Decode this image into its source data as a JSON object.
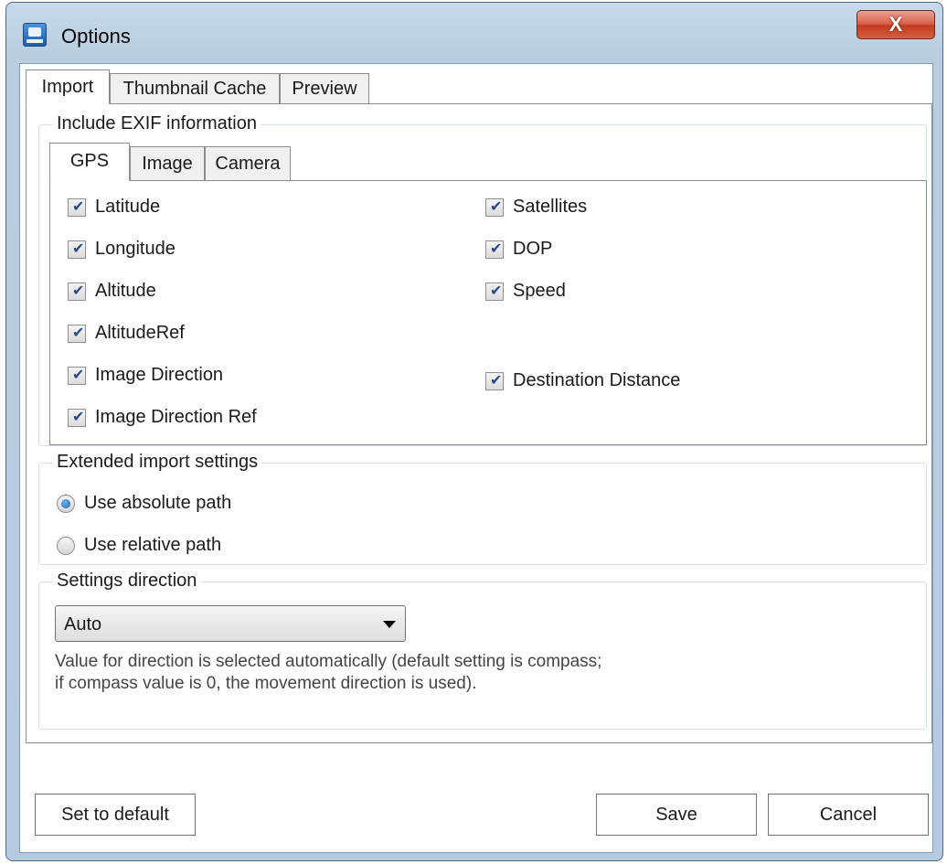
{
  "window": {
    "title": "Options",
    "close_label": "X"
  },
  "main_tabs": [
    {
      "label": "Import",
      "active": true
    },
    {
      "label": "Thumbnail Cache",
      "active": false
    },
    {
      "label": "Preview",
      "active": false
    }
  ],
  "exif_group": {
    "label": "Include EXIF information",
    "tabs": [
      {
        "label": "GPS",
        "active": true
      },
      {
        "label": "Image",
        "active": false
      },
      {
        "label": "Camera",
        "active": false
      }
    ],
    "left_checkboxes": [
      {
        "label": "Latitude",
        "checked": true
      },
      {
        "label": "Longitude",
        "checked": true
      },
      {
        "label": "Altitude",
        "checked": true
      },
      {
        "label": "AltitudeRef",
        "checked": true
      },
      {
        "label": "Image Direction",
        "checked": true
      },
      {
        "label": "Image Direction Ref",
        "checked": true
      }
    ],
    "right_checkboxes": [
      {
        "label": "Satellites",
        "checked": true
      },
      {
        "label": "DOP",
        "checked": true
      },
      {
        "label": "Speed",
        "checked": true
      },
      {
        "label": "Destination Distance",
        "checked": true
      }
    ]
  },
  "extended_group": {
    "label": "Extended import settings",
    "options": [
      {
        "label": "Use absolute path",
        "selected": true
      },
      {
        "label": "Use relative path",
        "selected": false
      }
    ]
  },
  "direction_group": {
    "label": "Settings direction",
    "selected_value": "Auto",
    "description_line1": "Value for direction is selected automatically (default setting is compass;",
    "description_line2": "if compass value is 0, the movement direction is used)."
  },
  "buttons": {
    "default_label": "Set to default",
    "save_label": "Save",
    "cancel_label": "Cancel"
  },
  "check_glyph": "✔"
}
